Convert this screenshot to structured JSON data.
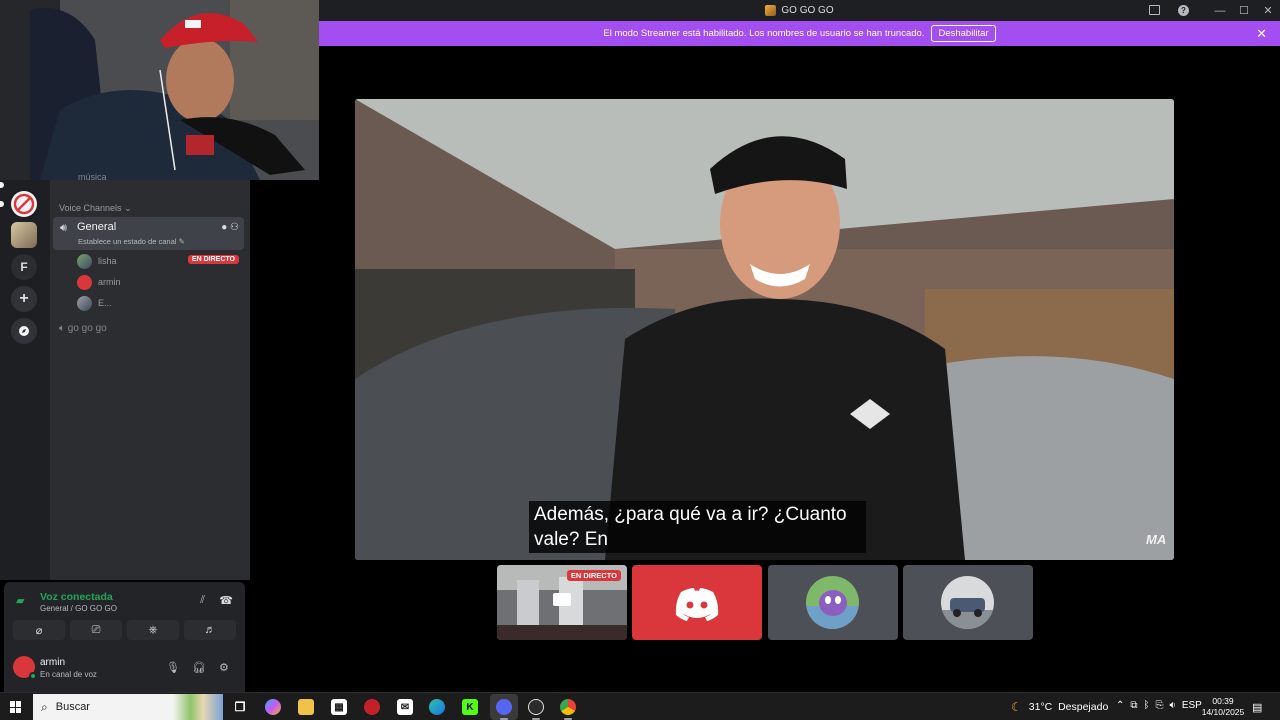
{
  "window": {
    "title": "GO GO GO"
  },
  "banner": {
    "text": "El modo Streamer está habilitado. Los nombres de usuario se han truncado.",
    "button": "Deshabilitar",
    "close": "✕"
  },
  "rail": {
    "letter_server": "F",
    "add": "+"
  },
  "sidebar": {
    "peek_channel": "música",
    "category": "Voice Channels",
    "voice_channel": {
      "name": "General",
      "status_prompt": "Establece un estado de canal ✎"
    },
    "members": [
      {
        "name": "lisha",
        "live": "EN DIRECTO"
      },
      {
        "name": "armin"
      },
      {
        "name": "E..."
      }
    ],
    "second_channel": "go go go"
  },
  "voice_panel": {
    "title": "Voz conectada",
    "path": "General / GO GO GO"
  },
  "user_panel": {
    "username": "armin",
    "status": "En canal de voz"
  },
  "stage": {
    "caption": "Además, ¿para qué va a ir?  ¿Cuanto vale?  En",
    "watermark": "MA"
  },
  "thumbnails": {
    "live_label": "EN DIRECTO"
  },
  "taskbar": {
    "search_placeholder": "Buscar",
    "weather_temp": "31°C",
    "weather_desc": "Despejado",
    "language": "ESP",
    "time": "00:39",
    "date": "14/10/2025"
  },
  "colors": {
    "banner": "#a34ef1",
    "live_red": "#da373c",
    "voice_green": "#23a55a",
    "discord_blurple": "#5865f2"
  }
}
